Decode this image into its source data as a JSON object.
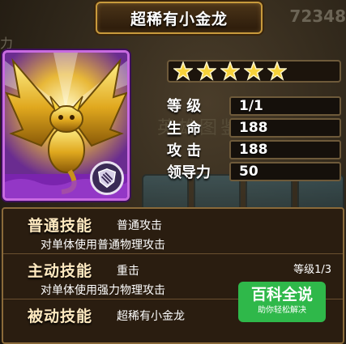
{
  "background": {
    "number": "72348",
    "left_glyph": "力",
    "side_text": "英雄图鉴"
  },
  "title": "超稀有小金龙",
  "stars": {
    "filled": 5,
    "total": 5
  },
  "stats": [
    {
      "label": "等 级",
      "value": "1/1"
    },
    {
      "label": "生 命",
      "value": "188"
    },
    {
      "label": "攻 击",
      "value": "188"
    },
    {
      "label": "领导力",
      "value": "50"
    }
  ],
  "skills": [
    {
      "type": "普通技能",
      "name": "普通攻击",
      "desc": "对单体使用普通物理攻击",
      "level": ""
    },
    {
      "type": "主动技能",
      "name": "重击",
      "desc": "对单体使用强力物理攻击",
      "level": "等级1/3"
    },
    {
      "type": "被动技能",
      "name": "超稀有小金龙",
      "desc": "",
      "level": ""
    }
  ],
  "watermark": {
    "main": "百科全说",
    "sub": "助你轻松解决"
  },
  "colors": {
    "card_border": "#c86ae0",
    "card_fill": "#8a2cc0",
    "gold": "#c89a3c",
    "watermark": "#2fb84a"
  },
  "icons": {
    "star": "star-icon",
    "badge": "shield-claw-icon"
  }
}
